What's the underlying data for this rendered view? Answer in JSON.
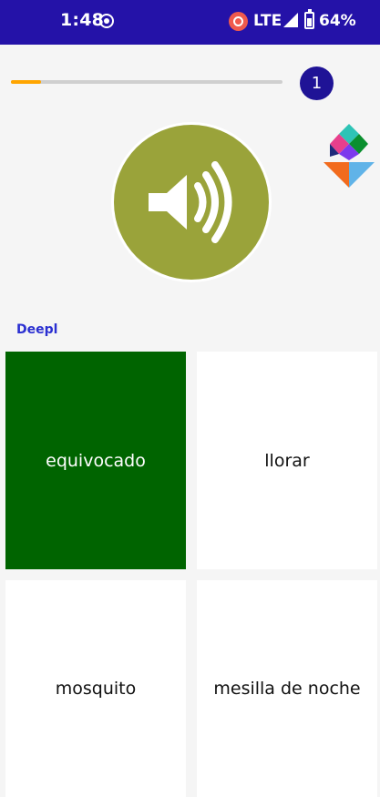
{
  "status_bar": {
    "time": "1:48",
    "network": "LTE",
    "battery": "64%",
    "icons": [
      "screen-record-icon",
      "hotspot-icon",
      "signal-icon",
      "battery-charging-icon"
    ]
  },
  "quiz": {
    "progress_fraction": 0.11,
    "progress_color": "#ffa500",
    "question_number": "1",
    "audio_button_icon": "speaker-icon",
    "audio_button_color": "#9aa33a",
    "source_label": "Deepl"
  },
  "answers": [
    {
      "label": "equivocado",
      "selected": true
    },
    {
      "label": "llorar",
      "selected": false
    },
    {
      "label": "mosquito",
      "selected": false
    },
    {
      "label": "mesilla de noche",
      "selected": false
    }
  ],
  "colors": {
    "status_bar": "#2412a8",
    "counter_badge": "#1f1396",
    "selected_tile": "#006400",
    "link": "#2a2fd1"
  }
}
